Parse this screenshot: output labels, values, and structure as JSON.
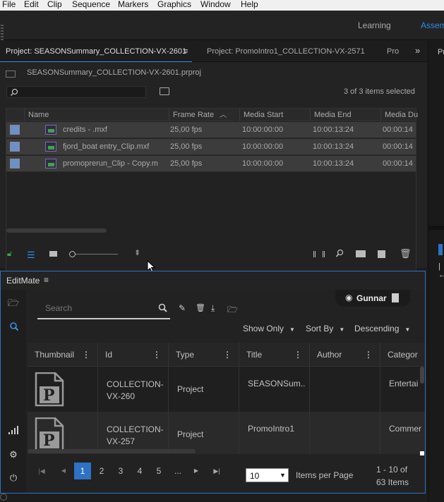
{
  "menu": [
    "File",
    "Edit",
    "Clip",
    "Sequence",
    "Markers",
    "Graphics",
    "Window",
    "Help"
  ],
  "workspaces": {
    "learning": "Learning",
    "assembly": "Assem"
  },
  "project_tabs": {
    "active": "Project: SEASONSummary_COLLECTION-VX-2601",
    "second": "Project: PromoIntro1_COLLECTION-VX-2571",
    "third": "Pro",
    "far_right": "Pr"
  },
  "project_file": "SEASONSummary_COLLECTION-VX-2601.prproj",
  "selection_status": "3 of 3 items selected",
  "columns": [
    "Name",
    "Frame Rate",
    "Media Start",
    "Media End",
    "Media Du"
  ],
  "clips": [
    {
      "name": "credits - .mxf",
      "rate": "25,00 fps",
      "start": "10:00:00:00",
      "end": "10:00:13:24",
      "dur": "00:00:14"
    },
    {
      "name": "fjord_boat entry_Clip.mxf",
      "rate": "25,00 fps",
      "start": "10:00:00:00",
      "end": "10:00:13:24",
      "dur": "00:00:14"
    },
    {
      "name": "promoprerun_Clip - Copy.m",
      "rate": "25,00 fps",
      "start": "10:00:00:00",
      "end": "10:00:13:24",
      "dur": "00:00:14"
    }
  ],
  "editmate": {
    "title": "EditMate",
    "user": "Gunnar",
    "search_placeholder": "Search",
    "filters": {
      "show_only": "Show Only",
      "sort_by": "Sort By",
      "order": "Descending"
    },
    "grid_columns": [
      "Thumbnail",
      "Id",
      "Type",
      "Title",
      "Author",
      "Categor"
    ],
    "rows": [
      {
        "id": "COLLECTION-VX-260",
        "type": "Project",
        "title": "SEASONSum..",
        "author": "",
        "category": "Entertai"
      },
      {
        "id": "COLLECTION-VX-257",
        "type": "Project",
        "title": "PromoIntro1",
        "author": "",
        "category": "Commer"
      }
    ],
    "thumb_letter": "P",
    "pages": [
      "1",
      "2",
      "3",
      "4",
      "5",
      "..."
    ],
    "per_page": "10",
    "per_page_label": "Items per Page",
    "range": "1 - 10 of",
    "total": "63 Items"
  },
  "colors": {
    "accent": "#2d8ceb",
    "selected_row": "#3c3c3c",
    "page_active": "#2d72c4"
  }
}
